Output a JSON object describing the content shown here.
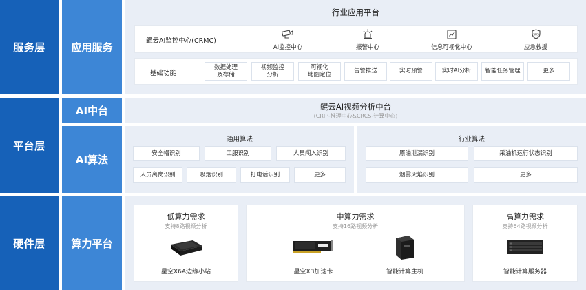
{
  "layers": {
    "service": {
      "label": "服务层",
      "sub": "应用服务"
    },
    "platform": {
      "label": "平台层",
      "sub_ai_center": "AI中台",
      "sub_ai_algo": "AI算法"
    },
    "hardware": {
      "label": "硬件层",
      "sub": "算力平台"
    }
  },
  "service": {
    "title": "行业应用平台",
    "crmc": {
      "name": "鲲云AI监控中心(CRMC)",
      "items": [
        {
          "label": "AI监控中心",
          "icon": "camera-icon"
        },
        {
          "label": "报警中心",
          "icon": "alarm-icon"
        },
        {
          "label": "信息可视化中心",
          "icon": "chart-icon"
        },
        {
          "label": "应急救援",
          "icon": "sos-icon"
        }
      ]
    },
    "basic": {
      "name": "基础功能",
      "chips": [
        "数据处理\n及存储",
        "视频监控\n分析",
        "可视化\n地图定位",
        "告警推送",
        "实时预警",
        "实时AI分析",
        "智能任务管理",
        "更多"
      ]
    }
  },
  "platform": {
    "title": "鲲云AI视频分析中台",
    "subtitle": "(CRIP-推理中心&CRCS-计算中心)",
    "general": {
      "title": "通用算法",
      "row1": [
        "安全帽识别",
        "工服识别",
        "人员闯入识别"
      ],
      "row2": [
        "人员离岗识别",
        "吸烟识别",
        "打电话识别",
        "更多"
      ]
    },
    "industry": {
      "title": "行业算法",
      "row1": [
        "原油泄漏识别",
        "采油机运行状态识别"
      ],
      "row2": [
        "烟雾火焰识别",
        "更多"
      ]
    }
  },
  "hardware": {
    "low": {
      "title": "低算力需求",
      "subtitle": "支持8路视频分析",
      "items": [
        "星空X6A边缘小站"
      ]
    },
    "mid": {
      "title": "中算力需求",
      "subtitle": "支持16路视频分析",
      "items": [
        "星空X3加速卡",
        "智能计算主机"
      ]
    },
    "high": {
      "title": "高算力需求",
      "subtitle": "支持64路视频分析",
      "items": [
        "智能计算服务器"
      ]
    }
  }
}
